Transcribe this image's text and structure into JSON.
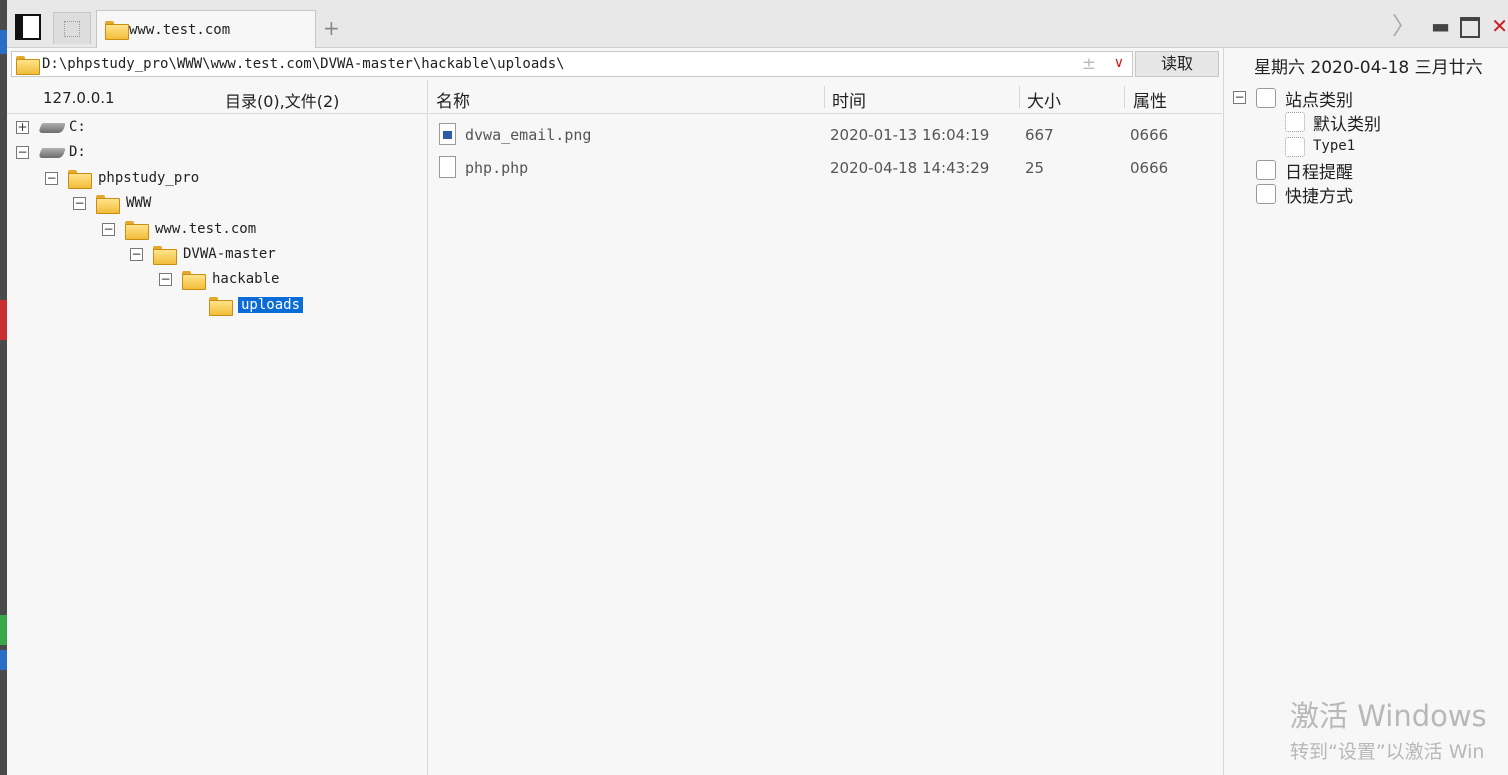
{
  "tabs": {
    "panel_toggle_icon": "panel-toggle-icon",
    "active_tab_label": "www.test.com",
    "add_tab_symbol": "+"
  },
  "window_controls": {
    "next_symbol": "〉",
    "minimize_symbol": "▬",
    "close_symbol": "✕"
  },
  "address_bar": {
    "path": "D:\\phpstudy_pro\\WWW\\www.test.com\\DVWA-master\\hackable\\uploads\\",
    "plus_symbol": "±",
    "dropdown_symbol": "∨",
    "read_button_label": "读取"
  },
  "left_pane": {
    "server_ip": "127.0.0.1",
    "dir_count": "目录(0),文件(2)",
    "tree": [
      {
        "label": "C:",
        "expander": "+",
        "type": "drive"
      },
      {
        "label": "D:",
        "expander": "−",
        "type": "drive"
      },
      {
        "label": "phpstudy_pro",
        "expander": "−",
        "type": "folder"
      },
      {
        "label": "WWW",
        "expander": "−",
        "type": "folder"
      },
      {
        "label": "www.test.com",
        "expander": "−",
        "type": "folder"
      },
      {
        "label": "DVWA-master",
        "expander": "−",
        "type": "folder"
      },
      {
        "label": "hackable",
        "expander": "−",
        "type": "folder"
      },
      {
        "label": "uploads",
        "expander": "",
        "type": "folder",
        "selected": true
      }
    ]
  },
  "file_list": {
    "columns": [
      "名称",
      "时间",
      "大小",
      "属性"
    ],
    "rows": [
      {
        "name": "dvwa_email.png",
        "time": "2020-01-13 16:04:19",
        "size": "667",
        "attr": "0666",
        "icon": "image-file-icon"
      },
      {
        "name": "php.php",
        "time": "2020-04-18 14:43:29",
        "size": "25",
        "attr": "0666",
        "icon": "blank-file-icon"
      }
    ]
  },
  "right_pane": {
    "date": "星期六  2020-04-18  三月廿六",
    "tree": [
      {
        "label": "站点类别",
        "expander": "−"
      },
      {
        "label": "默认类别"
      },
      {
        "label": "Type1"
      },
      {
        "label": "日程提醒"
      },
      {
        "label": "快捷方式"
      }
    ]
  },
  "watermark": {
    "line1": "激活 Windows",
    "line2": "转到“设置”以激活 Win"
  },
  "colors": {
    "selection": "#0a6cd6",
    "close_red": "#d21a1a",
    "folder_yellow": "#f2bd3a",
    "background": "#f7f7f7"
  }
}
